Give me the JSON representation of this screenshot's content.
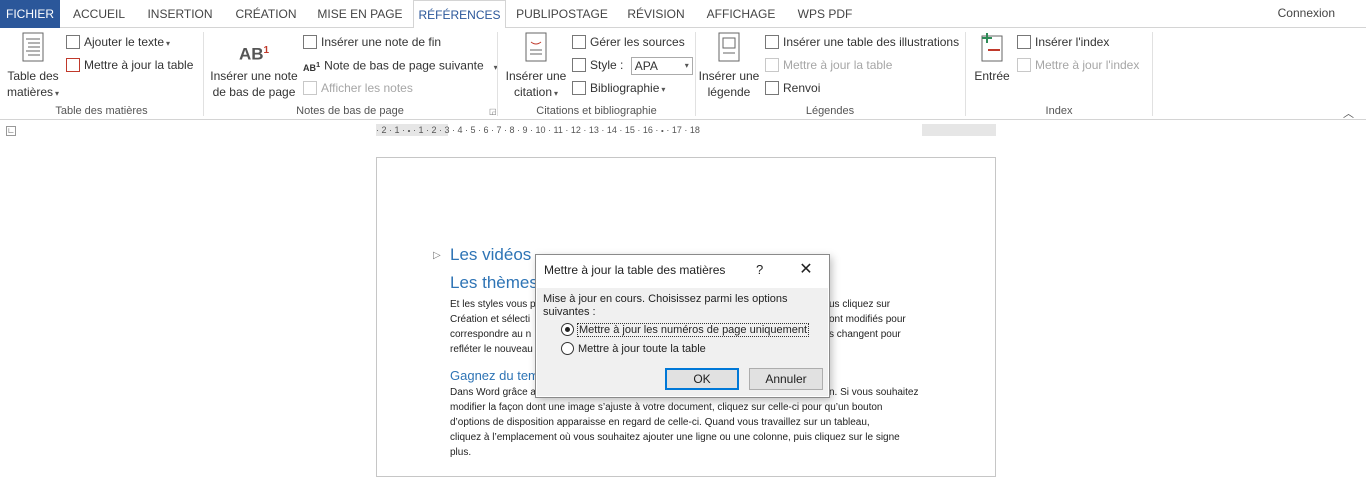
{
  "tabs": {
    "fichier": "FICHIER",
    "accueil": "ACCUEIL",
    "insertion": "INSERTION",
    "creation": "CRÉATION",
    "mise_en_page": "MISE EN PAGE",
    "references": "RÉFÉRENCES",
    "publipostage": "PUBLIPOSTAGE",
    "revision": "RÉVISION",
    "affichage": "AFFICHAGE",
    "wps_pdf": "WPS PDF",
    "login": "Connexion"
  },
  "ribbon": {
    "toc": {
      "big_line1": "Table des",
      "big_line2": "matières",
      "add_text": "Ajouter le texte",
      "update_table": "Mettre à jour la table",
      "label": "Table des matières"
    },
    "footnotes": {
      "big_line1": "Insérer une note",
      "big_line2": "de bas de page",
      "insert_endnote": "Insérer une note de fin",
      "next_footnote": "Note de bas de page suivante",
      "show_notes": "Afficher les notes",
      "label": "Notes de bas de page"
    },
    "citations": {
      "big_line1": "Insérer une",
      "big_line2": "citation",
      "manage_sources": "Gérer les sources",
      "style_label": "Style :",
      "style_value": "APA",
      "bibliography": "Bibliographie",
      "label": "Citations et bibliographie"
    },
    "captions": {
      "big_line1": "Insérer une",
      "big_line2": "légende",
      "insert_figures_table": "Insérer une table des illustrations",
      "update_table": "Mettre à jour la table",
      "cross_reference": "Renvoi",
      "label": "Légendes"
    },
    "index": {
      "big_label": "Entrée",
      "insert_index": "Insérer l'index",
      "update_index": "Mettre à jour l'index",
      "label": "Index"
    }
  },
  "ruler": {
    "ticks": "· 2 · 1 · 🞄 · 1 · 2 · 3 · 4 · 5 · 6 · 7 · 8 · 9 · 10 · 11 · 12 · 13 · 14 · 15 · 16 · 🞄 · 17 · 18"
  },
  "document": {
    "heading1": "Les vidéos",
    "heading2": "Les thèmes",
    "para1_line1": "Et les styles vous p",
    "para1_line1_end": "us cliquez sur",
    "para1_line2": "Création et sélecti",
    "para1_line2_end": "ont modifiés pour",
    "para1_line3": "correspondre au n",
    "para1_line3_end": "s changent pour",
    "para1_line4": "refléter le nouveau",
    "heading3": "Gagnez du tem",
    "para2_line1": "Dans Word grâce a",
    "para2_line1_end": "n. Si vous souhaitez",
    "para2_line2": "modifier la façon dont une image s’ajuste à votre document, cliquez sur celle-ci pour qu’un bouton",
    "para2_line3": "d’options de disposition apparaisse en regard de celle-ci. Quand vous travaillez sur un tableau,",
    "para2_line4": "cliquez à l’emplacement où vous souhaitez ajouter une ligne ou une colonne, puis cliquez sur le signe",
    "para2_line5": "plus."
  },
  "dialog": {
    "title": "Mettre à jour la table des matières",
    "help": "?",
    "close": "✕",
    "message": "Mise à jour en cours. Choisissez parmi les options suivantes :",
    "option1": "Mettre à jour les numéros de page uniquement",
    "option2": "Mettre à jour toute la table",
    "selected": "option1",
    "ok": "OK",
    "cancel": "Annuler"
  }
}
